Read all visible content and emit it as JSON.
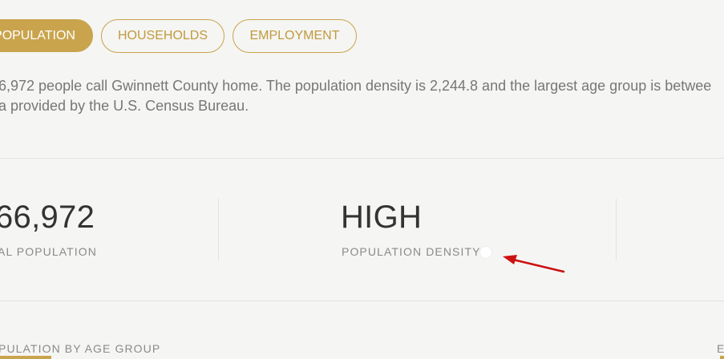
{
  "tabs": [
    {
      "label": "POPULATION",
      "active": true
    },
    {
      "label": "HOUSEHOLDS",
      "active": false
    },
    {
      "label": "EMPLOYMENT",
      "active": false
    }
  ],
  "description": {
    "line1": "6,972 people call Gwinnett County home. The population density is 2,244.8 and the largest age group is betwee",
    "line2": "a provided by the U.S. Census Bureau."
  },
  "stats": {
    "total_population": {
      "value": "66,972",
      "label": "AL POPULATION"
    },
    "population_density": {
      "value": "HIGH",
      "label": "POPULATION DENSITY",
      "info_icon": "info-icon"
    }
  },
  "sections": {
    "age_group_label": "PULATION BY AGE GROUP",
    "right_label": "E"
  },
  "colors": {
    "accent": "#c9a44c",
    "text_muted": "#777777",
    "annotation_arrow": "#cc1111"
  }
}
